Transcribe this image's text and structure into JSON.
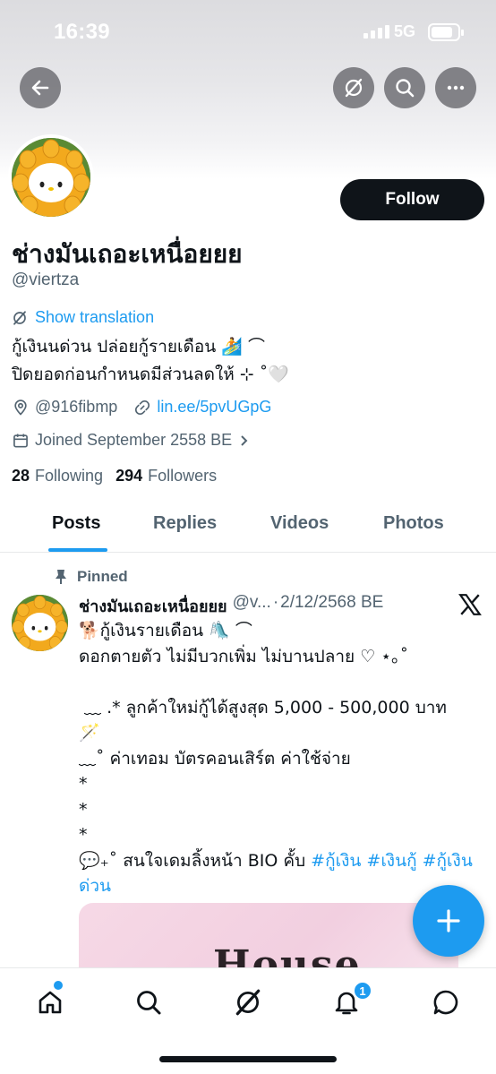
{
  "status_bar": {
    "time": "16:39",
    "network": "5G"
  },
  "header": {
    "back_icon": "arrow-left-icon",
    "actions": [
      "grok-icon",
      "search-icon",
      "more-icon"
    ]
  },
  "profile": {
    "display_name": "ช่างมันเถอะเหนื่อยยย",
    "handle": "@viertza",
    "follow_label": "Follow",
    "translate_label": "Show translation",
    "bio_line1": "กู้เงินนด่วน ปล่อยกู้รายเดือน 🏄 ⌒",
    "bio_line2": "ปิดยอดก่อนกำหนดมีส่วนลดให้ ⊹ ˚🤍",
    "location": "@916fibmp",
    "link": "lin.ee/5pvUGpG",
    "joined": "Joined September 2558 BE",
    "following_count": "28",
    "following_label": "Following",
    "followers_count": "294",
    "followers_label": "Followers"
  },
  "tabs": [
    {
      "label": "Posts",
      "active": true
    },
    {
      "label": "Replies",
      "active": false
    },
    {
      "label": "Videos",
      "active": false
    },
    {
      "label": "Photos",
      "active": false
    }
  ],
  "tweet": {
    "pinned_label": "Pinned",
    "author_name": "ช่างมันเถอะเหนื่อยยย",
    "author_handle": "@v...",
    "separator": "·",
    "date": "2/12/2568 BE",
    "body_text": "🐕กู้เงินรายเดือน 🛝 ⌒\nดอกตายตัว ไม่มีบวกเพิ่ม ไม่บานปลาย ♡ ⋆｡˚\n\n ﹏ .* ลูกค้าใหม่กู้ได้สูงสุด 5,000 - 500,000 บาท\n🪄\n﹏˚ ค่าเทอม บัตรคอนเสิร์ต ค่าใช้จ่าย\n*\n*\n*\n💬₊˚ สนใจเดมลิ้งหน้า BIO คั้บ ",
    "hashtags": "#กู้เงิน #เงินกู้ #กู้เงินด่วน",
    "media_text": "House"
  },
  "fab_icon": "plus-icon",
  "bottom_nav": {
    "items": [
      "home-icon",
      "search-icon",
      "grok-icon",
      "notifications-icon",
      "messages-icon"
    ],
    "notification_badge": "1"
  },
  "colors": {
    "accent": "#1d9bf0",
    "text": "#0f1419",
    "muted": "#536471"
  }
}
